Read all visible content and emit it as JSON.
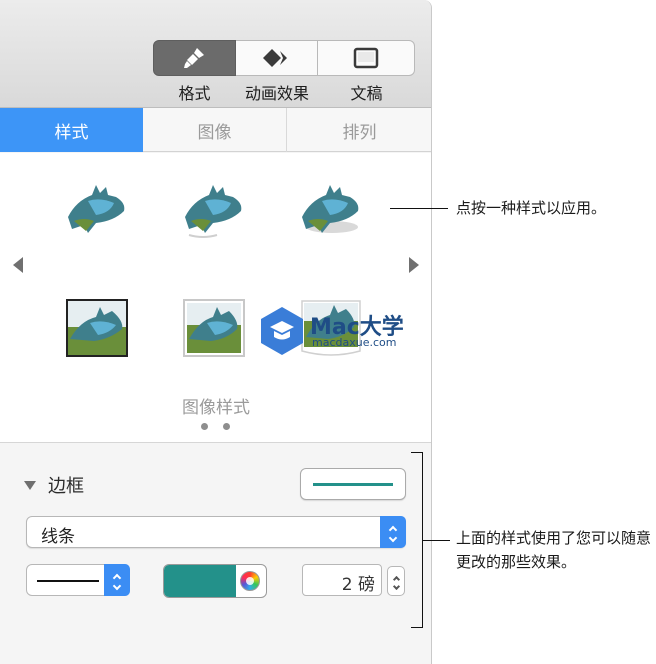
{
  "toolbar": {
    "format_label": "格式",
    "animate_label": "动画效果",
    "document_label": "文稿",
    "format_icon": "paintbrush-icon",
    "animate_icon": "diamond-arrow-icon",
    "document_icon": "document-icon"
  },
  "tabs": [
    {
      "label": "样式",
      "selected": true
    },
    {
      "label": "图像",
      "selected": false
    },
    {
      "label": "排列",
      "selected": false
    }
  ],
  "styles": {
    "caption": "图像样式",
    "pages": 2,
    "current_page": 1
  },
  "watermark": {
    "title": "Mac大学",
    "url": "macdaxue.com"
  },
  "border": {
    "title": "边框",
    "line_type": "线条",
    "color": "#23918a",
    "width_value": "2 磅"
  },
  "callouts": {
    "styles_hint": "点按一种样式以应用。",
    "edit_hint": "上面的样式使用了您可以随意更改的那些效果。"
  },
  "colors": {
    "accent": "#3d95f7",
    "border_color": "#23918a"
  }
}
